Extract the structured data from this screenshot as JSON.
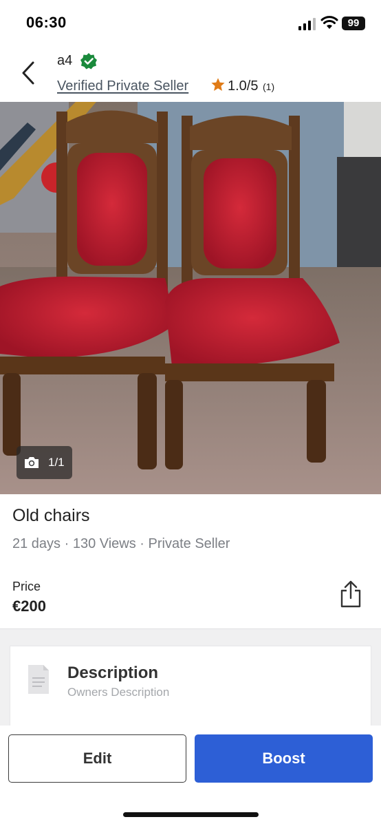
{
  "status_bar": {
    "time": "06:30",
    "battery": "99"
  },
  "header": {
    "seller_name": "a4",
    "seller_type": "Verified Private Seller",
    "rating": "1.0/5",
    "rating_count": "(1)",
    "icons": [
      "back-icon",
      "verified-icon",
      "star-icon"
    ]
  },
  "photo": {
    "counter": "1/1",
    "icon": "camera-icon"
  },
  "listing": {
    "title": "Old chairs",
    "meta": "21 days · 130 Views · Private Seller",
    "price_label": "Price",
    "price": "€200",
    "share_icon": "share-icon"
  },
  "description": {
    "title": "Description",
    "subtitle": "Owners Description",
    "icon": "document-icon"
  },
  "actions": {
    "edit_label": "Edit",
    "boost_label": "Boost"
  },
  "colors": {
    "accent": "#2d5fd6",
    "verified": "#1a8a3c",
    "star": "#e07b17"
  }
}
